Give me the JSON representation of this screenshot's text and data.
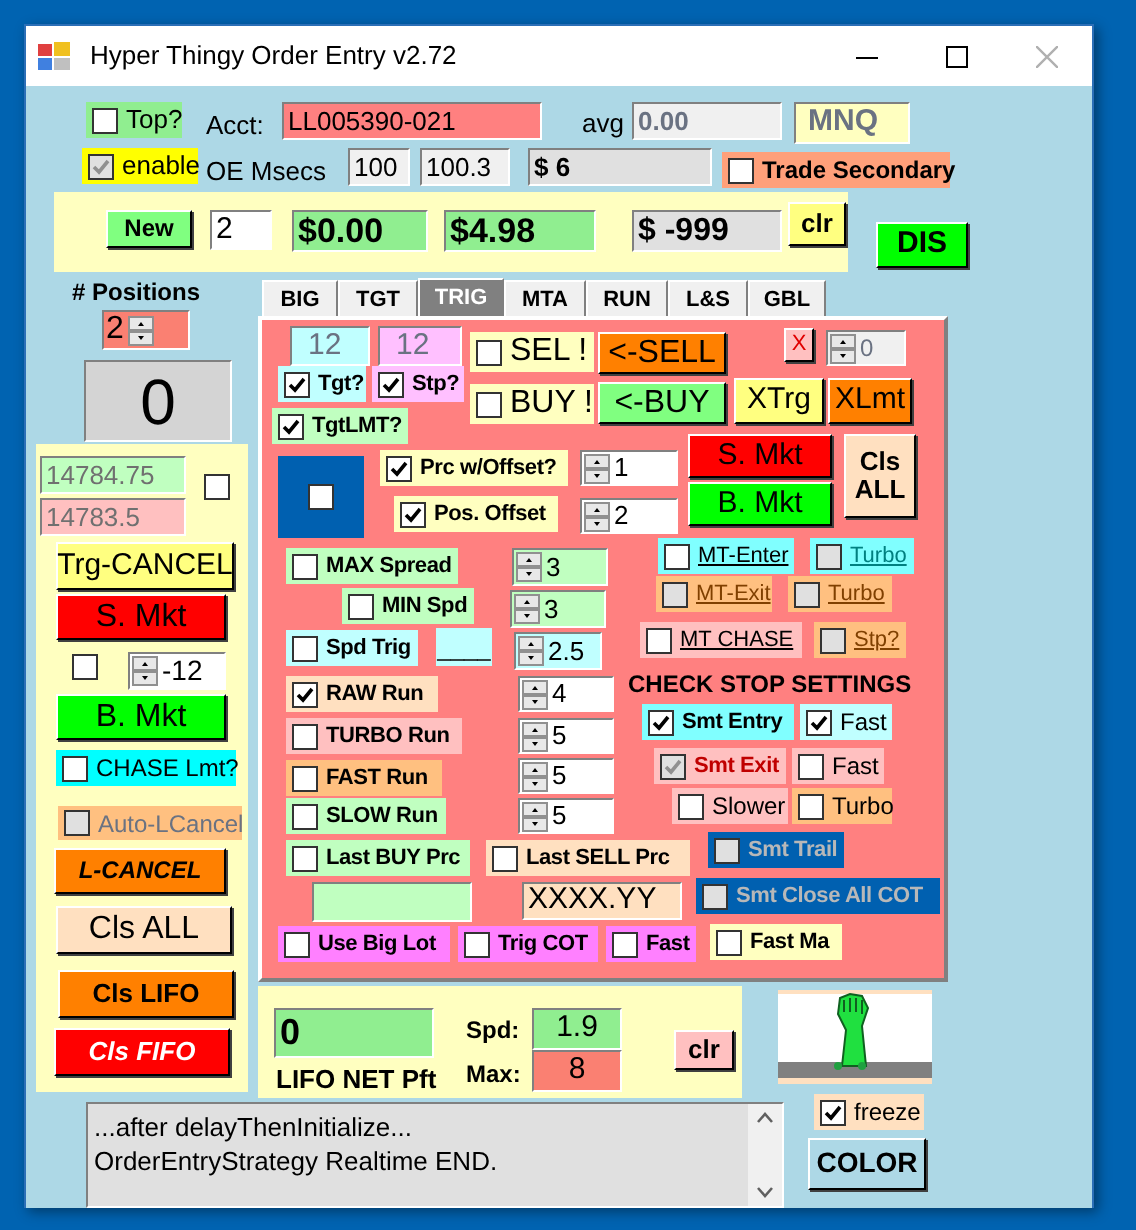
{
  "window": {
    "title": "Hyper Thingy Order Entry v2.72"
  },
  "header": [
    {
      "kind": "checkbox",
      "label": "Top?",
      "checked": false
    },
    {
      "kind": "label",
      "text": "Acct:"
    },
    {
      "kind": "field",
      "value": "LL005390-021"
    },
    {
      "kind": "label",
      "text": "avg"
    },
    {
      "kind": "field",
      "value": "0.00"
    },
    {
      "kind": "field",
      "value": "MNQ"
    },
    {
      "kind": "checkbox",
      "label": "enable",
      "checked": true,
      "disabled": true
    },
    {
      "kind": "label",
      "text": "OE Msecs"
    },
    {
      "kind": "field",
      "value": "100"
    },
    {
      "kind": "field",
      "value": "100.3"
    },
    {
      "kind": "field",
      "value": "$ 6"
    },
    {
      "kind": "checkbox",
      "label": "Trade Secondary",
      "checked": false
    },
    {
      "kind": "button",
      "text": "DIS"
    }
  ],
  "order_bar": [
    {
      "kind": "button",
      "text": "New"
    },
    {
      "kind": "field",
      "value": "2"
    },
    {
      "kind": "field",
      "value": "$0.00"
    },
    {
      "kind": "field",
      "value": "$4.98"
    },
    {
      "kind": "field",
      "value": "$ -999"
    },
    {
      "kind": "button",
      "text": "clr"
    }
  ],
  "positions": [
    {
      "kind": "label",
      "text": "# Positions"
    },
    {
      "kind": "spinner",
      "value": "2"
    },
    {
      "kind": "field",
      "value": "0"
    }
  ],
  "left_panel": [
    {
      "kind": "field",
      "value": "14784.75"
    },
    {
      "kind": "field",
      "value": "14783.5"
    },
    {
      "kind": "checkbox",
      "checked": false
    },
    {
      "kind": "button",
      "text": "Trg-CANCEL"
    },
    {
      "kind": "button",
      "text": "S. Mkt"
    },
    {
      "kind": "checkbox",
      "checked": false
    },
    {
      "kind": "spinner",
      "value": "-12"
    },
    {
      "kind": "button",
      "text": "B. Mkt"
    },
    {
      "kind": "checkbox",
      "label": "CHASE Lmt?",
      "checked": false
    },
    {
      "kind": "checkbox",
      "label": "Auto-LCancel",
      "checked": false,
      "disabled": true
    },
    {
      "kind": "button",
      "text": "L-CANCEL"
    },
    {
      "kind": "button",
      "text": "Cls ALL"
    },
    {
      "kind": "button",
      "text": "Cls LIFO"
    },
    {
      "kind": "button",
      "text": "Cls FIFO"
    }
  ],
  "tabs": [
    {
      "label": "BIG",
      "selected": false
    },
    {
      "label": "TGT",
      "selected": false
    },
    {
      "label": "TRIG",
      "selected": true
    },
    {
      "label": "MTA",
      "selected": false
    },
    {
      "label": "RUN",
      "selected": false
    },
    {
      "label": "L&S",
      "selected": false
    },
    {
      "label": "GBL",
      "selected": false
    }
  ],
  "trig_panel": [
    {
      "kind": "field",
      "value": "12"
    },
    {
      "kind": "field",
      "value": "12"
    },
    {
      "kind": "checkbox",
      "label": "Tgt?",
      "checked": true
    },
    {
      "kind": "checkbox",
      "label": "Stp?",
      "checked": true
    },
    {
      "kind": "checkbox",
      "label": "TgtLMT?",
      "checked": true
    },
    {
      "kind": "checkbox",
      "label": "SEL !",
      "checked": false
    },
    {
      "kind": "checkbox",
      "label": "BUY !",
      "checked": false
    },
    {
      "kind": "button",
      "text": "<-SELL"
    },
    {
      "kind": "button",
      "text": "<-BUY"
    },
    {
      "kind": "button",
      "text": "X"
    },
    {
      "kind": "spinner",
      "value": "0"
    },
    {
      "kind": "button",
      "text": "XTrg"
    },
    {
      "kind": "button",
      "text": "XLmt"
    },
    {
      "kind": "framed_checkbox",
      "checked": false
    },
    {
      "kind": "checkbox",
      "label": "Prc w/Offset?",
      "checked": true
    },
    {
      "kind": "checkbox",
      "label": "Pos. Offset",
      "checked": true
    },
    {
      "kind": "spinner",
      "value": "1"
    },
    {
      "kind": "spinner",
      "value": "2"
    },
    {
      "kind": "button",
      "text": "S. Mkt"
    },
    {
      "kind": "button",
      "text": "B. Mkt"
    },
    {
      "kind": "button",
      "text": "Cls ALL"
    },
    {
      "kind": "checkbox",
      "label": "MT-Enter",
      "checked": false
    },
    {
      "kind": "checkbox",
      "label": "Turbo",
      "checked": false,
      "disabled": true
    },
    {
      "kind": "checkbox",
      "label": "MAX Spread",
      "checked": false
    },
    {
      "kind": "spinner",
      "value": "3"
    },
    {
      "kind": "checkbox",
      "label": "MT-Exit",
      "checked": false,
      "disabled": true
    },
    {
      "kind": "checkbox",
      "label": "Turbo",
      "checked": false,
      "disabled": true
    },
    {
      "kind": "checkbox",
      "label": "MIN Spd",
      "checked": false
    },
    {
      "kind": "spinner",
      "value": "3"
    },
    {
      "kind": "checkbox",
      "label": "Spd Trig",
      "checked": false
    },
    {
      "kind": "label",
      "text": "____"
    },
    {
      "kind": "spinner",
      "value": "2.5"
    },
    {
      "kind": "checkbox",
      "label": "MT CHASE",
      "checked": false
    },
    {
      "kind": "checkbox",
      "label": "Stp?",
      "checked": false,
      "disabled": true
    },
    {
      "kind": "label",
      "text": "CHECK STOP SETTINGS"
    },
    {
      "kind": "checkbox",
      "label": "RAW Run",
      "checked": true
    },
    {
      "kind": "spinner",
      "value": "4"
    },
    {
      "kind": "checkbox",
      "label": "Smt Entry",
      "checked": true
    },
    {
      "kind": "checkbox",
      "label": "Fast",
      "checked": true
    },
    {
      "kind": "checkbox",
      "label": "TURBO Run",
      "checked": false
    },
    {
      "kind": "spinner",
      "value": "5"
    },
    {
      "kind": "checkbox",
      "label": "Smt Exit",
      "checked": true,
      "disabled": true
    },
    {
      "kind": "checkbox",
      "label": "Fast",
      "checked": false
    },
    {
      "kind": "checkbox",
      "label": "FAST Run",
      "checked": false
    },
    {
      "kind": "spinner",
      "value": "5"
    },
    {
      "kind": "checkbox",
      "label": "Slower",
      "checked": false
    },
    {
      "kind": "checkbox",
      "label": "Turbo",
      "checked": false
    },
    {
      "kind": "checkbox",
      "label": "SLOW Run",
      "checked": false
    },
    {
      "kind": "spinner",
      "value": "5"
    },
    {
      "kind": "checkbox",
      "label": "Smt Trail",
      "checked": false,
      "disabled": true
    },
    {
      "kind": "checkbox",
      "label": "Last BUY Prc",
      "checked": false
    },
    {
      "kind": "checkbox",
      "label": "Last SELL Prc",
      "checked": false
    },
    {
      "kind": "field"
    },
    {
      "kind": "field",
      "value": "XXXX.YY"
    },
    {
      "kind": "checkbox",
      "label": "Smt Close All COT",
      "checked": false,
      "disabled": true
    },
    {
      "kind": "checkbox",
      "label": "Use Big Lot",
      "checked": false
    },
    {
      "kind": "checkbox",
      "label": "Trig COT",
      "checked": false
    },
    {
      "kind": "checkbox",
      "label": "Fast",
      "checked": false
    },
    {
      "kind": "checkbox",
      "label": "Fast Ma",
      "checked": false
    }
  ],
  "profit_panel": [
    {
      "kind": "field",
      "value": "0"
    },
    {
      "kind": "label",
      "text": "LIFO NET Pft"
    },
    {
      "kind": "label",
      "text": "Spd:"
    },
    {
      "kind": "label",
      "text": "Max:"
    },
    {
      "kind": "field",
      "value": "1.9"
    },
    {
      "kind": "field",
      "value": "8"
    },
    {
      "kind": "button",
      "text": "clr"
    }
  ],
  "side": [
    {
      "kind": "checkbox",
      "label": "freeze",
      "checked": true
    },
    {
      "kind": "button",
      "text": "COLOR"
    }
  ],
  "log": {
    "lines": [
      "...after delayThenInitialize...",
      "OrderEntryStrategy Realtime END."
    ]
  }
}
